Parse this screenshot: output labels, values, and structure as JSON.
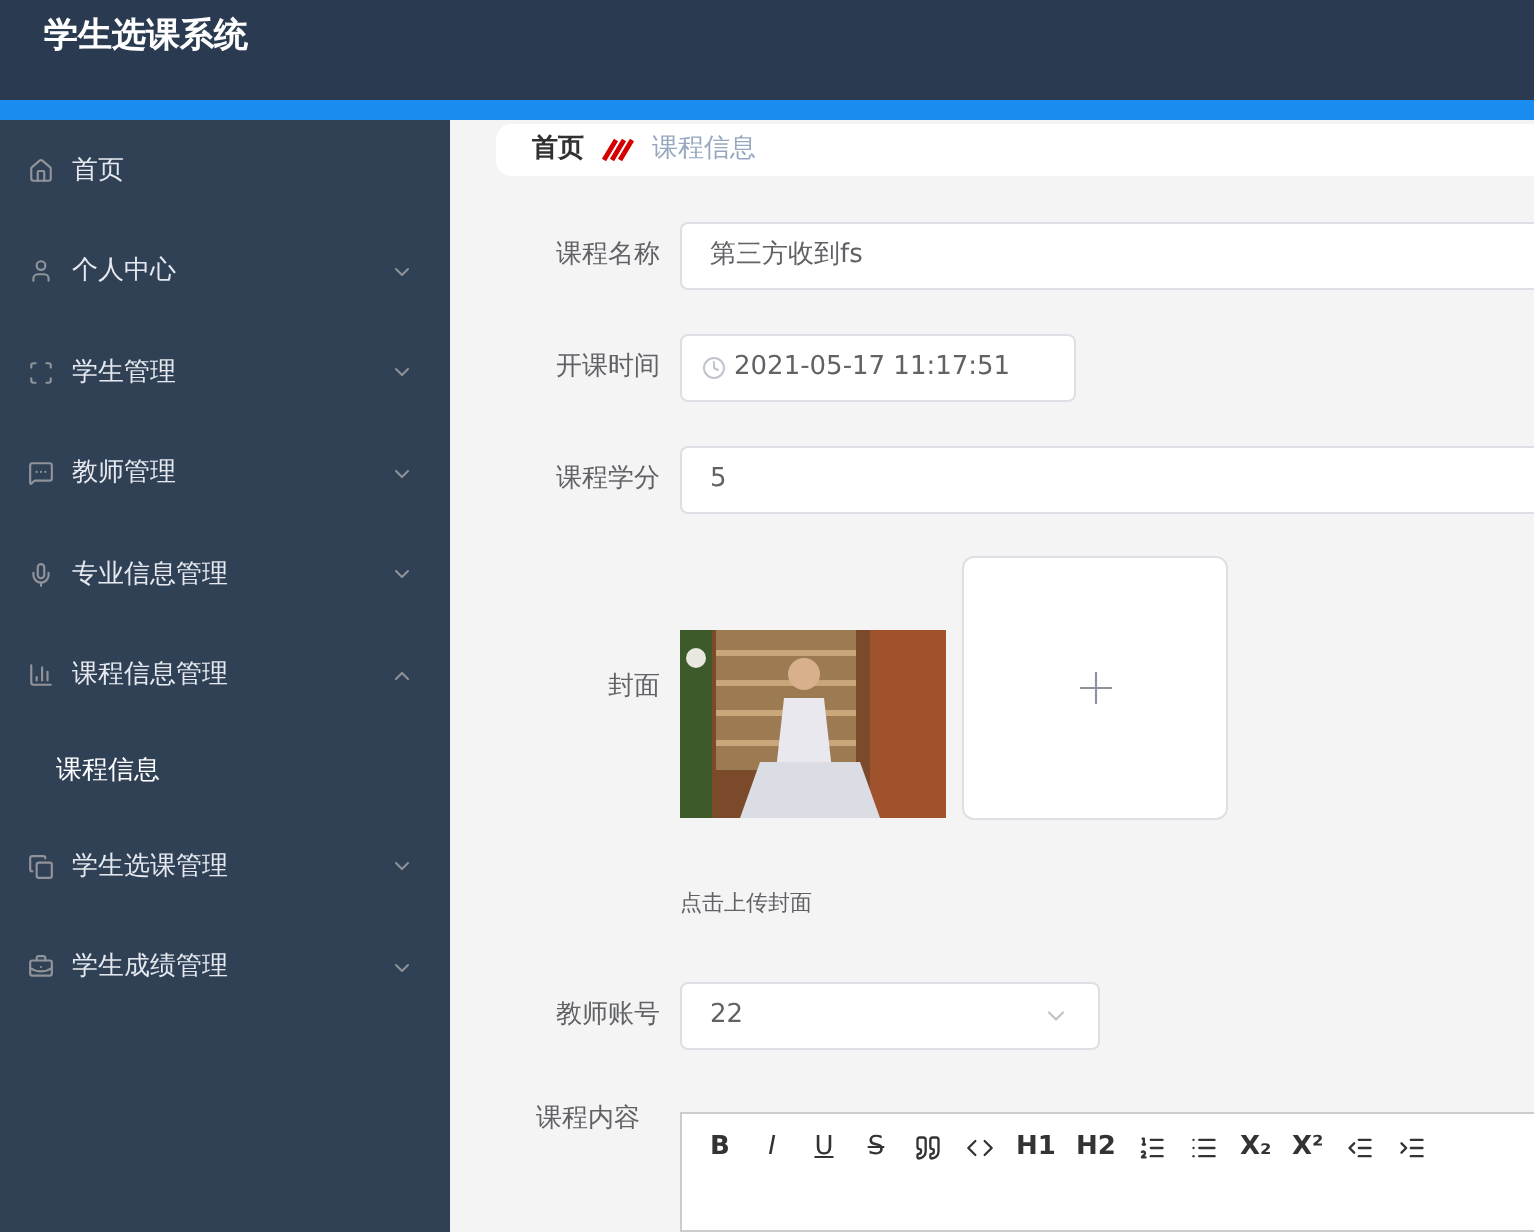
{
  "header": {
    "title": "学生选课系统"
  },
  "sidebar": {
    "items": [
      {
        "label": "首页"
      },
      {
        "label": "个人中心",
        "expanded": false
      },
      {
        "label": "学生管理",
        "expanded": false
      },
      {
        "label": "教师管理",
        "expanded": false
      },
      {
        "label": "专业信息管理",
        "expanded": false
      },
      {
        "label": "课程信息管理",
        "expanded": true,
        "children": [
          {
            "label": "课程信息"
          }
        ]
      },
      {
        "label": "学生选课管理",
        "expanded": false
      },
      {
        "label": "学生成绩管理",
        "expanded": false
      }
    ]
  },
  "breadcrumb": [
    {
      "label": "首页",
      "selected": false
    },
    {
      "label": "课程信息",
      "selected": true
    }
  ],
  "form": {
    "course_name": {
      "label": "课程名称",
      "value": "第三方收到fs"
    },
    "start_time": {
      "label": "开课时间",
      "value": "2021-05-17 11:17:51"
    },
    "credits": {
      "label": "课程学分",
      "value": "5"
    },
    "cover": {
      "label": "封面",
      "hint": "点击上传封面"
    },
    "teacher": {
      "label": "教师账号",
      "value": "22"
    },
    "content": {
      "label": "课程内容",
      "toolbar": [
        {
          "kind": "text",
          "label": "B"
        },
        {
          "kind": "text",
          "label": "I"
        },
        {
          "kind": "text",
          "label": "U"
        },
        {
          "kind": "text",
          "label": "S"
        },
        {
          "kind": "icon"
        },
        {
          "kind": "icon"
        },
        {
          "kind": "text",
          "label": "H1"
        },
        {
          "kind": "text",
          "label": "H2"
        },
        {
          "kind": "icon"
        },
        {
          "kind": "icon"
        },
        {
          "kind": "text",
          "label": "X₂"
        },
        {
          "kind": "text",
          "label": "X²"
        },
        {
          "kind": "icon"
        },
        {
          "kind": "icon"
        }
      ]
    }
  }
}
